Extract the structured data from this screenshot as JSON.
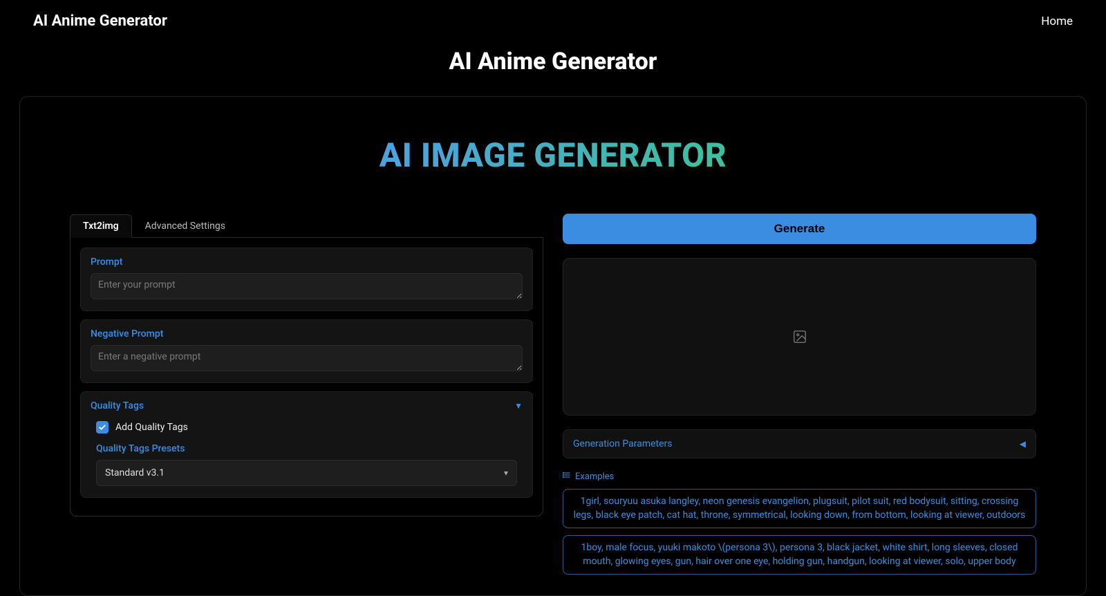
{
  "nav": {
    "logo": "AI Anime Generator",
    "home": "Home"
  },
  "page_title": "AI Anime Generator",
  "hero": "AI IMAGE GENERATOR",
  "tabs": {
    "txt2img": "Txt2img",
    "advanced": "Advanced Settings"
  },
  "prompt": {
    "label": "Prompt",
    "placeholder": "Enter your prompt"
  },
  "neg_prompt": {
    "label": "Negative Prompt",
    "placeholder": "Enter a negative prompt"
  },
  "quality": {
    "header": "Quality Tags",
    "checkbox_label": "Add Quality Tags",
    "preset_label": "Quality Tags Presets",
    "preset_value": "Standard v3.1"
  },
  "generate_label": "Generate",
  "gen_params_label": "Generation Parameters",
  "examples_label": "Examples",
  "examples": {
    "e0": "1girl, souryuu asuka langley, neon genesis evangelion, plugsuit, pilot suit, red bodysuit, sitting, crossing legs, black eye patch, cat hat, throne, symmetrical, looking down, from bottom, looking at viewer, outdoors",
    "e1": "1boy, male focus, yuuki makoto \\(persona 3\\), persona 3, black jacket, white shirt, long sleeves, closed mouth, glowing eyes, gun, hair over one eye, holding gun, handgun, looking at viewer, solo, upper body"
  }
}
